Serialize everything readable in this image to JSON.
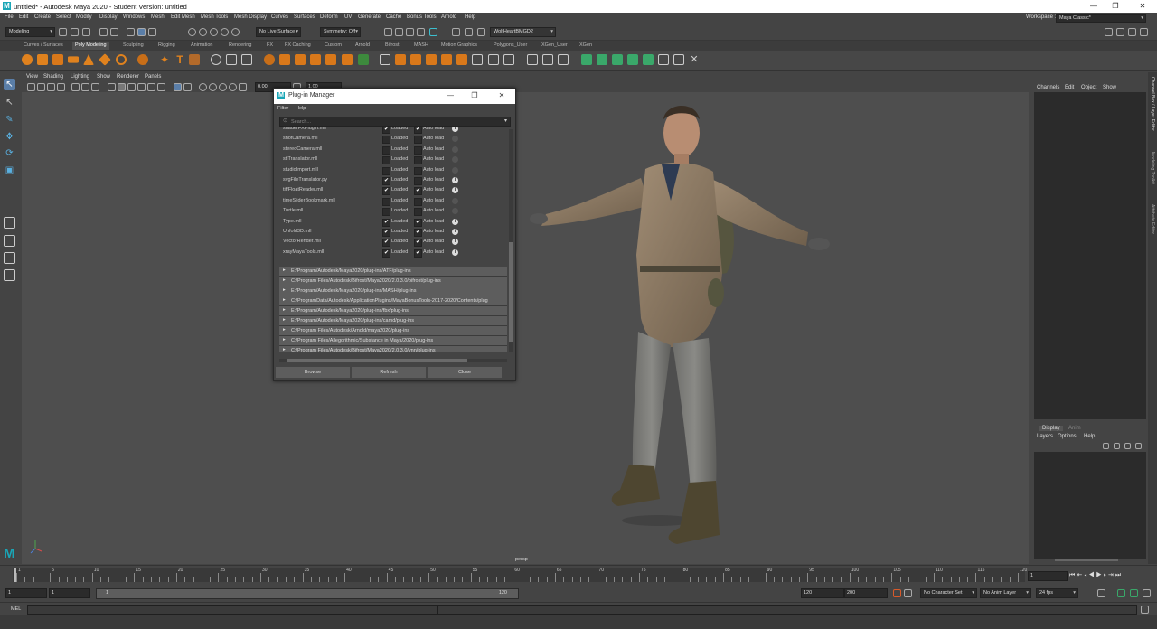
{
  "window": {
    "title": "untitled* - Autodesk Maya 2020 - Student Version: untitled",
    "logo": "M",
    "controls": [
      "—",
      "❐",
      "✕"
    ]
  },
  "menubar": {
    "items": [
      "File",
      "Edit",
      "Create",
      "Select",
      "Modify",
      "Display",
      "Windows",
      "Mesh",
      "Edit Mesh",
      "Mesh Tools",
      "Mesh Display",
      "Curves",
      "Surfaces",
      "Deform",
      "UV",
      "Generate",
      "Cache",
      "Bonus Tools",
      "Arnold",
      "Help"
    ],
    "workspace_label": "Workspace :",
    "workspace_value": "Maya Classic*"
  },
  "statusline": {
    "menuset": "Modeling",
    "live_surface": "No Live Surface",
    "symmetry": "Symmetry: Off",
    "account": "WolfHeartBMGD2"
  },
  "shelf_tabs": [
    "Curves / Surfaces",
    "Poly Modeling",
    "Sculpting",
    "Rigging",
    "Animation",
    "Rendering",
    "FX",
    "FX Caching",
    "Custom",
    "Arnold",
    "Bifrost",
    "MASH",
    "Motion Graphics",
    "Polygons_User",
    "XGen_User",
    "XGen"
  ],
  "shelf_active_tab": "Poly Modeling",
  "viewport": {
    "menus": [
      "View",
      "Shading",
      "Lighting",
      "Show",
      "Renderer",
      "Panels"
    ],
    "camera_label": "persp",
    "field_a": "0.00",
    "field_b": "1.00"
  },
  "channel_box": {
    "menus": [
      "Channels",
      "Edit",
      "Object",
      "Show"
    ],
    "layer_tabs": [
      "Display",
      "Anim"
    ],
    "layer_menus": [
      "Layers",
      "Options",
      "Help"
    ],
    "side_tabs": [
      "Channel Box / Layer Editor",
      "Modeling Toolkit",
      "Attribute Editor"
    ]
  },
  "plugin_manager": {
    "title": "Plug-in Manager",
    "menus": [
      "Filter",
      "Help"
    ],
    "search_placeholder": "Search...",
    "loaded_label": "Loaded",
    "autoload_label": "Auto load",
    "plugins": [
      {
        "name": "shaderFXPlugin.mll",
        "loaded": true,
        "autoload": true,
        "info": true
      },
      {
        "name": "shotCamera.mll",
        "loaded": false,
        "autoload": false,
        "info": false
      },
      {
        "name": "stereoCamera.mll",
        "loaded": false,
        "autoload": false,
        "info": false
      },
      {
        "name": "stlTranslator.mll",
        "loaded": false,
        "autoload": false,
        "info": false
      },
      {
        "name": "studioImport.mll",
        "loaded": false,
        "autoload": false,
        "info": false
      },
      {
        "name": "svgFileTranslator.py",
        "loaded": true,
        "autoload": false,
        "info": true
      },
      {
        "name": "tiffFloatReader.mll",
        "loaded": true,
        "autoload": true,
        "info": true
      },
      {
        "name": "timeSliderBookmark.mll",
        "loaded": false,
        "autoload": false,
        "info": false
      },
      {
        "name": "Turtle.mll",
        "loaded": false,
        "autoload": false,
        "info": false
      },
      {
        "name": "Type.mll",
        "loaded": true,
        "autoload": true,
        "info": true
      },
      {
        "name": "Unfold3D.mll",
        "loaded": true,
        "autoload": true,
        "info": true
      },
      {
        "name": "VectorRender.mll",
        "loaded": true,
        "autoload": true,
        "info": true
      },
      {
        "name": "xrayMayaTools.mll",
        "loaded": true,
        "autoload": true,
        "info": true
      }
    ],
    "paths": [
      "E:/Program/Autodesk/Maya2020/plug-ins/ATF/plug-ins",
      "C:/Program Files/Autodesk/Bifrost/Maya2020/2.0.3.0/bifrost/plug-ins",
      "E:/Program/Autodesk/Maya2020/plug-ins/MASH/plug-ins",
      "C:/ProgramData/Autodesk/ApplicationPlugins/MayaBonusTools-2017-2020/Contents/plug",
      "E:/Program/Autodesk/Maya2020/plug-ins/fbx/plug-ins",
      "E:/Program/Autodesk/Maya2020/plug-ins/camd/plug-ins",
      "C:/Program Files/Autodesk/Arnold/maya2020/plug-ins",
      "C:/Program Files/Allegorithmic/Substance in Maya/2020/plug-ins",
      "C:/Program Files/Autodesk/Bifrost/Maya2020/2.0.3.0/vnn/plug-ins"
    ],
    "buttons": {
      "browse": "Browse",
      "refresh": "Refresh",
      "close": "Close"
    }
  },
  "timeline": {
    "ticks": [
      "1",
      "5",
      "10",
      "15",
      "20",
      "25",
      "30",
      "35",
      "40",
      "45",
      "50",
      "55",
      "60",
      "65",
      "70",
      "75",
      "80",
      "85",
      "90",
      "95",
      "100",
      "105",
      "110",
      "115",
      "120"
    ],
    "current_frame": "1"
  },
  "range": {
    "start": "1",
    "inner_start": "1",
    "slider_start": "1",
    "slider_end": "120",
    "end": "120",
    "outer_end": "200",
    "character_set": "No Character Set",
    "anim_layer": "No Anim Layer",
    "fps": "24 fps"
  },
  "cmdline": {
    "label": "MEL"
  },
  "colors": {
    "accent_orange": "#e0821e",
    "maya_teal": "#1aa6b7",
    "panel": "#444444",
    "field": "#2b2b2b"
  }
}
